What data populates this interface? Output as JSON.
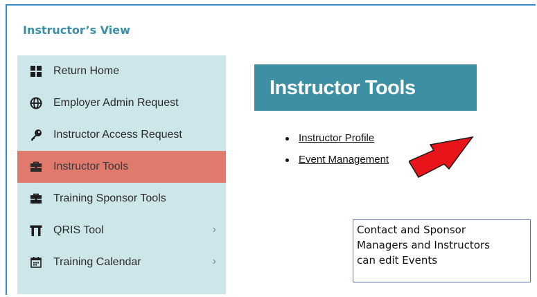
{
  "header": {
    "view_title": "Instructor’s View"
  },
  "sidebar": {
    "items": [
      {
        "label": "Return Home",
        "icon": "grid-icon",
        "active": false,
        "has_chevron": false
      },
      {
        "label": "Employer Admin Request",
        "icon": "globe-icon",
        "active": false,
        "has_chevron": false
      },
      {
        "label": "Instructor Access Request",
        "icon": "key-icon",
        "active": false,
        "has_chevron": false
      },
      {
        "label": "Instructor Tools",
        "icon": "toolbox-icon",
        "active": true,
        "has_chevron": false
      },
      {
        "label": "Training Sponsor Tools",
        "icon": "toolbox-icon",
        "active": false,
        "has_chevron": false
      },
      {
        "label": "QRIS Tool",
        "icon": "torii-icon",
        "active": false,
        "has_chevron": true
      },
      {
        "label": "Training Calendar",
        "icon": "calendar-icon",
        "active": false,
        "has_chevron": true
      }
    ],
    "chevron": "›"
  },
  "main": {
    "title": "Instructor Tools",
    "links": [
      {
        "label": "Instructor Profile"
      },
      {
        "label": "Event Management"
      }
    ]
  },
  "note": {
    "lines": [
      "Contact and Sponsor",
      "Managers and Instructors",
      "can edit Events"
    ]
  },
  "colors": {
    "accent": "#3d8fa3",
    "sidebar_bg": "#cde6e9",
    "active_item": "#e07a6d",
    "arrow": "#e8141a"
  }
}
